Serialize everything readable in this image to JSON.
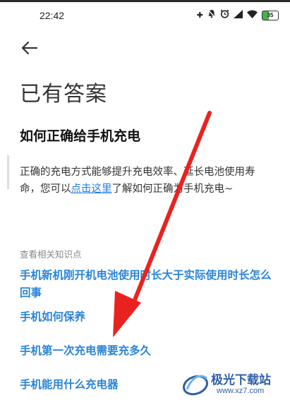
{
  "status_bar": {
    "time": "22:42",
    "battery": "35",
    "icons": [
      "plus-icon",
      "bell-off-icon",
      "alarm-icon",
      "signal-icon",
      "wifi-icon",
      "battery-icon"
    ]
  },
  "page_title": "已有答案",
  "question": "如何正确给手机充电",
  "answer": {
    "text_before": "正确的充电方式能够提升充电效率、延长电池使用寿命，您可以",
    "link_text": "点击这里",
    "text_after": "了解如何正确为手机充电~"
  },
  "related": {
    "heading": "查看相关知识点",
    "items": [
      "手机新机刚开机电池使用时长大于实际使用时长怎么回事",
      "手机如何保养",
      "手机第一次充电需要充多久",
      "手机能用什么充电器"
    ]
  },
  "watermark": {
    "name": "极光下载站",
    "url": "www.xz7.com"
  },
  "colors": {
    "link": "#2a84d8",
    "annotation_arrow": "#e8231f"
  }
}
